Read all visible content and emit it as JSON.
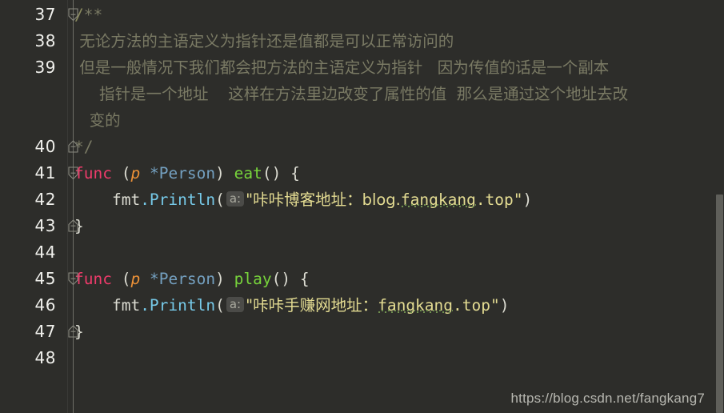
{
  "editor": {
    "language": "go",
    "background_color": "#2d2d2a",
    "gutter": {
      "line_numbers": [
        "37",
        "38",
        "39",
        "40",
        "41",
        "42",
        "43",
        "44",
        "45",
        "46",
        "47",
        "48"
      ]
    },
    "scrollbar": {
      "name": "vertical-scrollbar"
    },
    "lines": [
      {
        "number": "37",
        "fold": "open",
        "tokens": [
          {
            "text": "/",
            "kind": "comment-slash"
          },
          {
            "text": "**",
            "kind": "comment"
          }
        ]
      },
      {
        "number": "38",
        "fold": "none",
        "tokens": [
          {
            "text": " 无论方法的主语定义为指针还是值都是可以正常访问的",
            "kind": "comment"
          }
        ]
      },
      {
        "number": "39",
        "fold": "none",
        "tokens": [
          {
            "text": " 但是一般情况下我们都会把方法的主语定义为指针   因为传值的话是一个副本",
            "kind": "comment"
          }
        ],
        "wrapped": [
          "     指针是一个地址    这样在方法里边改变了属性的值  那么是通过这个地址去改",
          "   变的"
        ]
      },
      {
        "number": "40",
        "fold": "close",
        "tokens": [
          {
            "text": "*/",
            "kind": "comment"
          }
        ]
      },
      {
        "number": "41",
        "fold": "open",
        "tokens": [
          {
            "text": "func",
            "kind": "kw"
          },
          {
            "text": " ",
            "kind": "plain"
          },
          {
            "text": "(",
            "kind": "paren"
          },
          {
            "text": "p",
            "kind": "recv"
          },
          {
            "text": " ",
            "kind": "plain"
          },
          {
            "text": "*Person",
            "kind": "type"
          },
          {
            "text": ")",
            "kind": "paren"
          },
          {
            "text": " ",
            "kind": "plain"
          },
          {
            "text": "eat",
            "kind": "func"
          },
          {
            "text": "()",
            "kind": "paren"
          },
          {
            "text": " ",
            "kind": "plain"
          },
          {
            "text": "{",
            "kind": "brace"
          }
        ]
      },
      {
        "number": "42",
        "fold": "none",
        "tokens": [
          {
            "text": "    fmt",
            "kind": "plain"
          },
          {
            "text": ".Println",
            "kind": "method"
          },
          {
            "text": "(",
            "kind": "paren"
          },
          {
            "text": "a:",
            "kind": "hint"
          },
          {
            "text": "\"咔咔博客地址：blog.",
            "kind": "str"
          },
          {
            "text": "fangkang",
            "kind": "str-typo"
          },
          {
            "text": ".top\"",
            "kind": "str"
          },
          {
            "text": ")",
            "kind": "paren"
          }
        ]
      },
      {
        "number": "43",
        "fold": "close",
        "tokens": [
          {
            "text": "}",
            "kind": "brace"
          }
        ]
      },
      {
        "number": "44",
        "fold": "none",
        "tokens": []
      },
      {
        "number": "45",
        "fold": "open",
        "tokens": [
          {
            "text": "func",
            "kind": "kw"
          },
          {
            "text": " ",
            "kind": "plain"
          },
          {
            "text": "(",
            "kind": "paren"
          },
          {
            "text": "p",
            "kind": "recv"
          },
          {
            "text": " ",
            "kind": "plain"
          },
          {
            "text": "*Person",
            "kind": "type"
          },
          {
            "text": ")",
            "kind": "paren"
          },
          {
            "text": " ",
            "kind": "plain"
          },
          {
            "text": "play",
            "kind": "func"
          },
          {
            "text": "()",
            "kind": "paren"
          },
          {
            "text": " ",
            "kind": "plain"
          },
          {
            "text": "{",
            "kind": "brace"
          }
        ]
      },
      {
        "number": "46",
        "fold": "none",
        "tokens": [
          {
            "text": "    fmt",
            "kind": "plain"
          },
          {
            "text": ".Println",
            "kind": "method"
          },
          {
            "text": "(",
            "kind": "paren"
          },
          {
            "text": "a:",
            "kind": "hint"
          },
          {
            "text": "\"咔咔手赚网地址：",
            "kind": "str"
          },
          {
            "text": "fangkang",
            "kind": "str-typo"
          },
          {
            "text": ".top\"",
            "kind": "str"
          },
          {
            "text": ")",
            "kind": "paren"
          }
        ]
      },
      {
        "number": "47",
        "fold": "close",
        "tokens": [
          {
            "text": "}",
            "kind": "brace"
          }
        ]
      },
      {
        "number": "48",
        "fold": "none",
        "tokens": []
      }
    ]
  },
  "watermark": {
    "text": "https://blog.csdn.net/fangkang7"
  },
  "colors": {
    "background": "#2d2d2a",
    "line_number": "#f0f0ec",
    "comment": "#7a7a64",
    "keyword": "#ef3b6b",
    "receiver": "#ec9137",
    "type": "#74a0c0",
    "function": "#77d43b",
    "method": "#76c9e8",
    "string": "#e4dc92",
    "hint_badge_bg": "#4b4b48",
    "typo_underline": "#6f8f4f",
    "scrollbar_thumb": "#5f5f5a"
  }
}
